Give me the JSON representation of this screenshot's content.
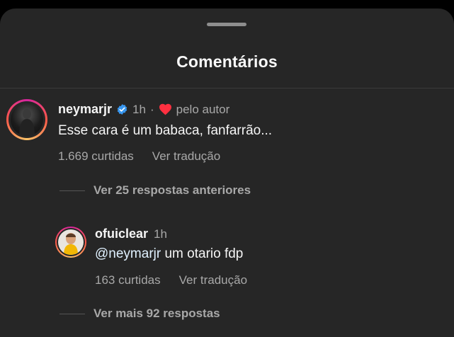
{
  "sheet": {
    "title": "Comentários"
  },
  "comment": {
    "username": "neymarjr",
    "time": "1h",
    "separator": "·",
    "liked_by_author": "pelo autor",
    "text": "Esse cara é um babaca, fanfarrão...",
    "likes": "1.669 curtidas",
    "translate": "Ver tradução",
    "view_previous": "Ver 25 respostas anteriores"
  },
  "reply": {
    "username": "ofuiclear",
    "time": "1h",
    "mention": "@neymarjr",
    "text": " um otario fdp",
    "likes": "163 curtidas",
    "translate": "Ver tradução",
    "view_more": "Ver mais 92 respostas"
  },
  "colors": {
    "background": "#262626",
    "verified": "#3897f0",
    "heart": "#ff3040"
  }
}
